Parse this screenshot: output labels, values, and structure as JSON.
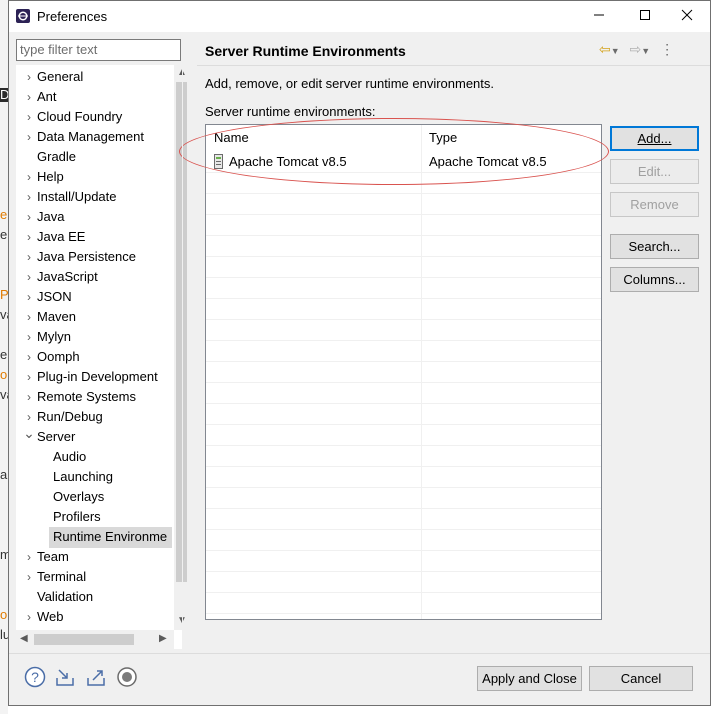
{
  "window": {
    "title": "Preferences",
    "minimize_icon": "minimize-icon",
    "maximize_icon": "maximize-icon",
    "close_icon": "close-icon"
  },
  "filter": {
    "placeholder": "type filter text"
  },
  "tree": {
    "items": [
      {
        "label": "General",
        "expandable": true
      },
      {
        "label": "Ant",
        "expandable": true
      },
      {
        "label": "Cloud Foundry",
        "expandable": true
      },
      {
        "label": "Data Management",
        "expandable": true
      },
      {
        "label": "Gradle",
        "expandable": false
      },
      {
        "label": "Help",
        "expandable": true
      },
      {
        "label": "Install/Update",
        "expandable": true
      },
      {
        "label": "Java",
        "expandable": true
      },
      {
        "label": "Java EE",
        "expandable": true
      },
      {
        "label": "Java Persistence",
        "expandable": true
      },
      {
        "label": "JavaScript",
        "expandable": true
      },
      {
        "label": "JSON",
        "expandable": true
      },
      {
        "label": "Maven",
        "expandable": true
      },
      {
        "label": "Mylyn",
        "expandable": true
      },
      {
        "label": "Oomph",
        "expandable": true
      },
      {
        "label": "Plug-in Development",
        "expandable": true
      },
      {
        "label": "Remote Systems",
        "expandable": true
      },
      {
        "label": "Run/Debug",
        "expandable": true
      },
      {
        "label": "Server",
        "expandable": true,
        "expanded": true
      },
      {
        "label": "Audio",
        "child": true
      },
      {
        "label": "Launching",
        "child": true
      },
      {
        "label": "Overlays",
        "child": true
      },
      {
        "label": "Profilers",
        "child": true
      },
      {
        "label": "Runtime Environme",
        "child": true,
        "selected": true
      },
      {
        "label": "Team",
        "expandable": true
      },
      {
        "label": "Terminal",
        "expandable": true
      },
      {
        "label": "Validation",
        "expandable": false
      },
      {
        "label": "Web",
        "expandable": true
      }
    ]
  },
  "page": {
    "title": "Server Runtime Environments",
    "description": "Add, remove, or edit server runtime environments.",
    "list_label": "Server runtime environments:"
  },
  "table": {
    "columns": [
      "Name",
      "Type"
    ],
    "rows": [
      {
        "name": "Apache Tomcat v8.5",
        "type": "Apache Tomcat v8.5",
        "icon": "server-icon"
      }
    ]
  },
  "buttons": {
    "add": "Add...",
    "edit": "Edit...",
    "remove": "Remove",
    "search": "Search...",
    "columns": "Columns...",
    "apply_close": "Apply and Close",
    "cancel": "Cancel"
  },
  "background_fragments": [
    "D",
    "e",
    "e",
    "P",
    "va",
    "e",
    "o",
    "va",
    "a",
    "m",
    "ol",
    "lu"
  ],
  "accent_colors": {
    "annotation_oval": "#d9534f",
    "default_button_border": "#0078d7"
  }
}
